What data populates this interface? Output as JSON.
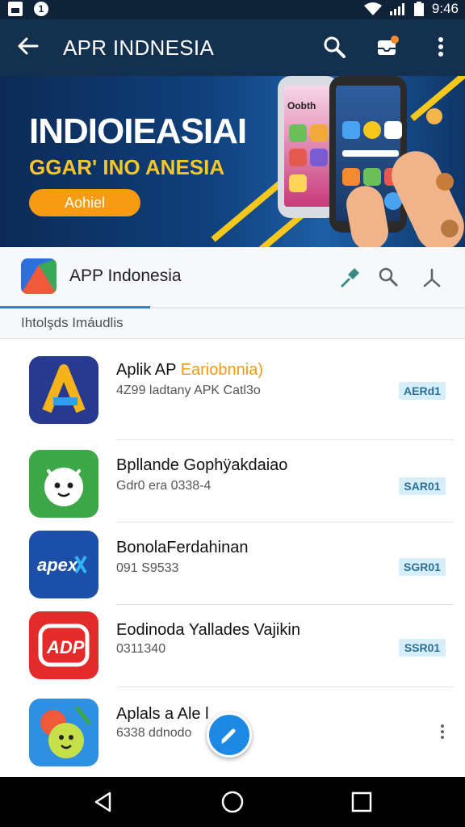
{
  "status_bar": {
    "time": "9:46"
  },
  "app_bar": {
    "title": "APR INDNESIA",
    "icons": [
      "back-arrow-icon",
      "search-icon",
      "inbox-icon",
      "more-vert-icon"
    ]
  },
  "banner": {
    "headline": "INDIOIEASIAI",
    "subheadline": "GGAR' INO ANESIA",
    "cta_label": "Aohiel",
    "phone_text": "Oobth",
    "colors": {
      "background": "#10407c",
      "accent": "#f6c81d",
      "cta": "#f89a12"
    }
  },
  "app_header": {
    "name": "APP Indonesia",
    "icons": [
      "pin-icon",
      "search-icon",
      "share-icon"
    ]
  },
  "section_label": "Ihtolşds Imáudlis",
  "apps": [
    {
      "title": "Aplik AP ",
      "title_accent": "Eariobnnia)",
      "subtitle": "4Z99 ladtany APK Catl3o",
      "badge": "AERd1",
      "icon": "a-letter-icon"
    },
    {
      "title": "Bpllande Gophÿakdaiao",
      "subtitle": "Gdr0 era 0338-4",
      "badge": "SAR01",
      "icon": "android-face-icon"
    },
    {
      "title": "BonolaFerdahinan",
      "subtitle": "091 S9533",
      "badge": "SGR01",
      "icon": "apex-logo-icon"
    },
    {
      "title": "Eodinoda Yallades Vajikin",
      "subtitle": "0311340",
      "badge": "SSR01",
      "icon": "adp-logo-icon"
    },
    {
      "title": "Aplals a Ale l",
      "subtitle": "6338 ddnodo",
      "badge": "",
      "icon": "cartoon-fruit-icon"
    }
  ],
  "fab": {
    "icon": "edit-pencil-icon"
  },
  "nav_bar": {
    "icons": [
      "nav-back-icon",
      "nav-home-icon",
      "nav-recents-icon"
    ]
  }
}
